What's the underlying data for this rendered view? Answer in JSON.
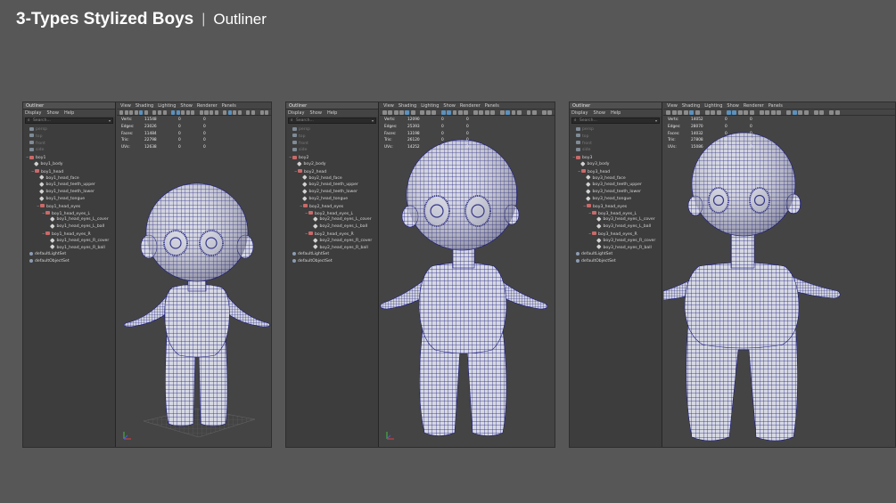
{
  "header": {
    "title": "3-Types Stylized Boys",
    "separator": "|",
    "subtitle": "Outliner"
  },
  "menus": {
    "outliner_title": "Outliner",
    "outliner_menu": [
      "Display",
      "Show",
      "Help"
    ],
    "search_placeholder": "Search...",
    "viewport_menu": [
      "View",
      "Shading",
      "Lighting",
      "Show",
      "Renderer",
      "Panels"
    ]
  },
  "hud_labels": [
    "Verts:",
    "Edges:",
    "Faces:",
    "Tris:",
    "UVs:"
  ],
  "colors": {
    "background": "#575757",
    "mesh_fill": "#d6d8e3",
    "mesh_wire": "#1c1c80",
    "panel": "#444444",
    "outliner": "#3d3d3d"
  },
  "panels": [
    {
      "name": "boy1",
      "stats": [
        [
          "11548",
          "0",
          "0"
        ],
        [
          "23026",
          "0",
          "0"
        ],
        [
          "11484",
          "0",
          "0"
        ],
        [
          "22798",
          "0",
          "0"
        ],
        [
          "12638",
          "0",
          "0"
        ]
      ],
      "tree": [
        {
          "label": "persp",
          "depth": 0,
          "icon": "cam",
          "dim": true
        },
        {
          "label": "top",
          "depth": 0,
          "icon": "cam",
          "dim": true
        },
        {
          "label": "front",
          "depth": 0,
          "icon": "cam",
          "dim": true
        },
        {
          "label": "side",
          "depth": 0,
          "icon": "cam",
          "dim": true
        },
        {
          "label": "boy1",
          "depth": 0,
          "icon": "grp",
          "exp": "⊟"
        },
        {
          "label": "boy1_body",
          "depth": 1,
          "icon": "mesh"
        },
        {
          "label": "boy1_head",
          "depth": 1,
          "icon": "grp",
          "exp": "⊟"
        },
        {
          "label": "boy1_head_face",
          "depth": 2,
          "icon": "mesh"
        },
        {
          "label": "boy1_head_teeth_upper",
          "depth": 2,
          "icon": "mesh"
        },
        {
          "label": "boy1_head_teeth_lower",
          "depth": 2,
          "icon": "mesh"
        },
        {
          "label": "boy1_head_tongue",
          "depth": 2,
          "icon": "mesh"
        },
        {
          "label": "boy1_head_eyes",
          "depth": 2,
          "icon": "grp",
          "exp": "⊟"
        },
        {
          "label": "boy1_head_eyes_L",
          "depth": 3,
          "icon": "grp",
          "exp": "⊟"
        },
        {
          "label": "boy1_head_eyes_L_cover",
          "depth": 4,
          "icon": "mesh"
        },
        {
          "label": "boy1_head_eyes_L_ball",
          "depth": 4,
          "icon": "mesh"
        },
        {
          "label": "boy1_head_eyes_R",
          "depth": 3,
          "icon": "grp",
          "exp": "⊟"
        },
        {
          "label": "boy1_head_eyes_R_cover",
          "depth": 4,
          "icon": "mesh"
        },
        {
          "label": "boy1_head_eyes_R_ball",
          "depth": 4,
          "icon": "mesh"
        },
        {
          "label": "defaultLightSet",
          "depth": 0,
          "icon": "set"
        },
        {
          "label": "defaultObjectSet",
          "depth": 0,
          "icon": "set"
        }
      ]
    },
    {
      "name": "boy2",
      "stats": [
        [
          "12090",
          "0",
          "0"
        ],
        [
          "25393",
          "0",
          "0"
        ],
        [
          "13198",
          "0",
          "0"
        ],
        [
          "26120",
          "0",
          "0"
        ],
        [
          "14252",
          "0",
          "0"
        ]
      ],
      "tree": [
        {
          "label": "persp",
          "depth": 0,
          "icon": "cam",
          "dim": true
        },
        {
          "label": "top",
          "depth": 0,
          "icon": "cam",
          "dim": true
        },
        {
          "label": "front",
          "depth": 0,
          "icon": "cam",
          "dim": true
        },
        {
          "label": "side",
          "depth": 0,
          "icon": "cam",
          "dim": true
        },
        {
          "label": "boy2",
          "depth": 0,
          "icon": "grp",
          "exp": "⊟"
        },
        {
          "label": "boy2_body",
          "depth": 1,
          "icon": "mesh"
        },
        {
          "label": "boy2_head",
          "depth": 1,
          "icon": "grp",
          "exp": "⊟"
        },
        {
          "label": "boy2_head_face",
          "depth": 2,
          "icon": "mesh"
        },
        {
          "label": "boy2_head_teeth_upper",
          "depth": 2,
          "icon": "mesh"
        },
        {
          "label": "boy2_head_teeth_lower",
          "depth": 2,
          "icon": "mesh"
        },
        {
          "label": "boy2_head_tongue",
          "depth": 2,
          "icon": "mesh"
        },
        {
          "label": "boy2_head_eyes",
          "depth": 2,
          "icon": "grp",
          "exp": "⊟"
        },
        {
          "label": "boy2_head_eyes_L",
          "depth": 3,
          "icon": "grp",
          "exp": "⊟"
        },
        {
          "label": "boy2_head_eyes_L_cover",
          "depth": 4,
          "icon": "mesh"
        },
        {
          "label": "boy2_head_eyes_L_ball",
          "depth": 4,
          "icon": "mesh"
        },
        {
          "label": "boy2_head_eyes_R",
          "depth": 3,
          "icon": "grp",
          "exp": "⊟"
        },
        {
          "label": "boy2_head_eyes_R_cover",
          "depth": 4,
          "icon": "mesh"
        },
        {
          "label": "boy2_head_eyes_R_ball",
          "depth": 4,
          "icon": "mesh"
        },
        {
          "label": "defaultLightSet",
          "depth": 0,
          "icon": "set"
        },
        {
          "label": "defaultObjectSet",
          "depth": 0,
          "icon": "set"
        }
      ]
    },
    {
      "name": "boy3",
      "stats": [
        [
          "14052",
          "0",
          "0"
        ],
        [
          "28070",
          "0",
          "0"
        ],
        [
          "14032",
          "0",
          "0"
        ],
        [
          "27808",
          "0",
          "0"
        ],
        [
          "15086",
          "0",
          "0"
        ]
      ],
      "tree": [
        {
          "label": "persp",
          "depth": 0,
          "icon": "cam",
          "dim": true
        },
        {
          "label": "top",
          "depth": 0,
          "icon": "cam",
          "dim": true
        },
        {
          "label": "front",
          "depth": 0,
          "icon": "cam",
          "dim": true
        },
        {
          "label": "side",
          "depth": 0,
          "icon": "cam",
          "dim": true
        },
        {
          "label": "boy3",
          "depth": 0,
          "icon": "grp",
          "exp": "⊟"
        },
        {
          "label": "boy3_body",
          "depth": 1,
          "icon": "mesh"
        },
        {
          "label": "boy3_head",
          "depth": 1,
          "icon": "grp",
          "exp": "⊟"
        },
        {
          "label": "boy3_head_face",
          "depth": 2,
          "icon": "mesh"
        },
        {
          "label": "boy3_head_teeth_upper",
          "depth": 2,
          "icon": "mesh"
        },
        {
          "label": "boy3_head_teeth_lower",
          "depth": 2,
          "icon": "mesh"
        },
        {
          "label": "boy3_head_tongue",
          "depth": 2,
          "icon": "mesh"
        },
        {
          "label": "boy3_head_eyes",
          "depth": 2,
          "icon": "grp",
          "exp": "⊟"
        },
        {
          "label": "boy3_head_eyes_L",
          "depth": 3,
          "icon": "grp",
          "exp": "⊟"
        },
        {
          "label": "boy3_head_eyes_L_cover",
          "depth": 4,
          "icon": "mesh"
        },
        {
          "label": "boy3_head_eyes_L_ball",
          "depth": 4,
          "icon": "mesh"
        },
        {
          "label": "boy3_head_eyes_R",
          "depth": 3,
          "icon": "grp",
          "exp": "⊟"
        },
        {
          "label": "boy3_head_eyes_R_cover",
          "depth": 4,
          "icon": "mesh"
        },
        {
          "label": "boy3_head_eyes_R_ball",
          "depth": 4,
          "icon": "mesh"
        },
        {
          "label": "defaultLightSet",
          "depth": 0,
          "icon": "set"
        },
        {
          "label": "defaultObjectSet",
          "depth": 0,
          "icon": "set"
        }
      ]
    }
  ]
}
